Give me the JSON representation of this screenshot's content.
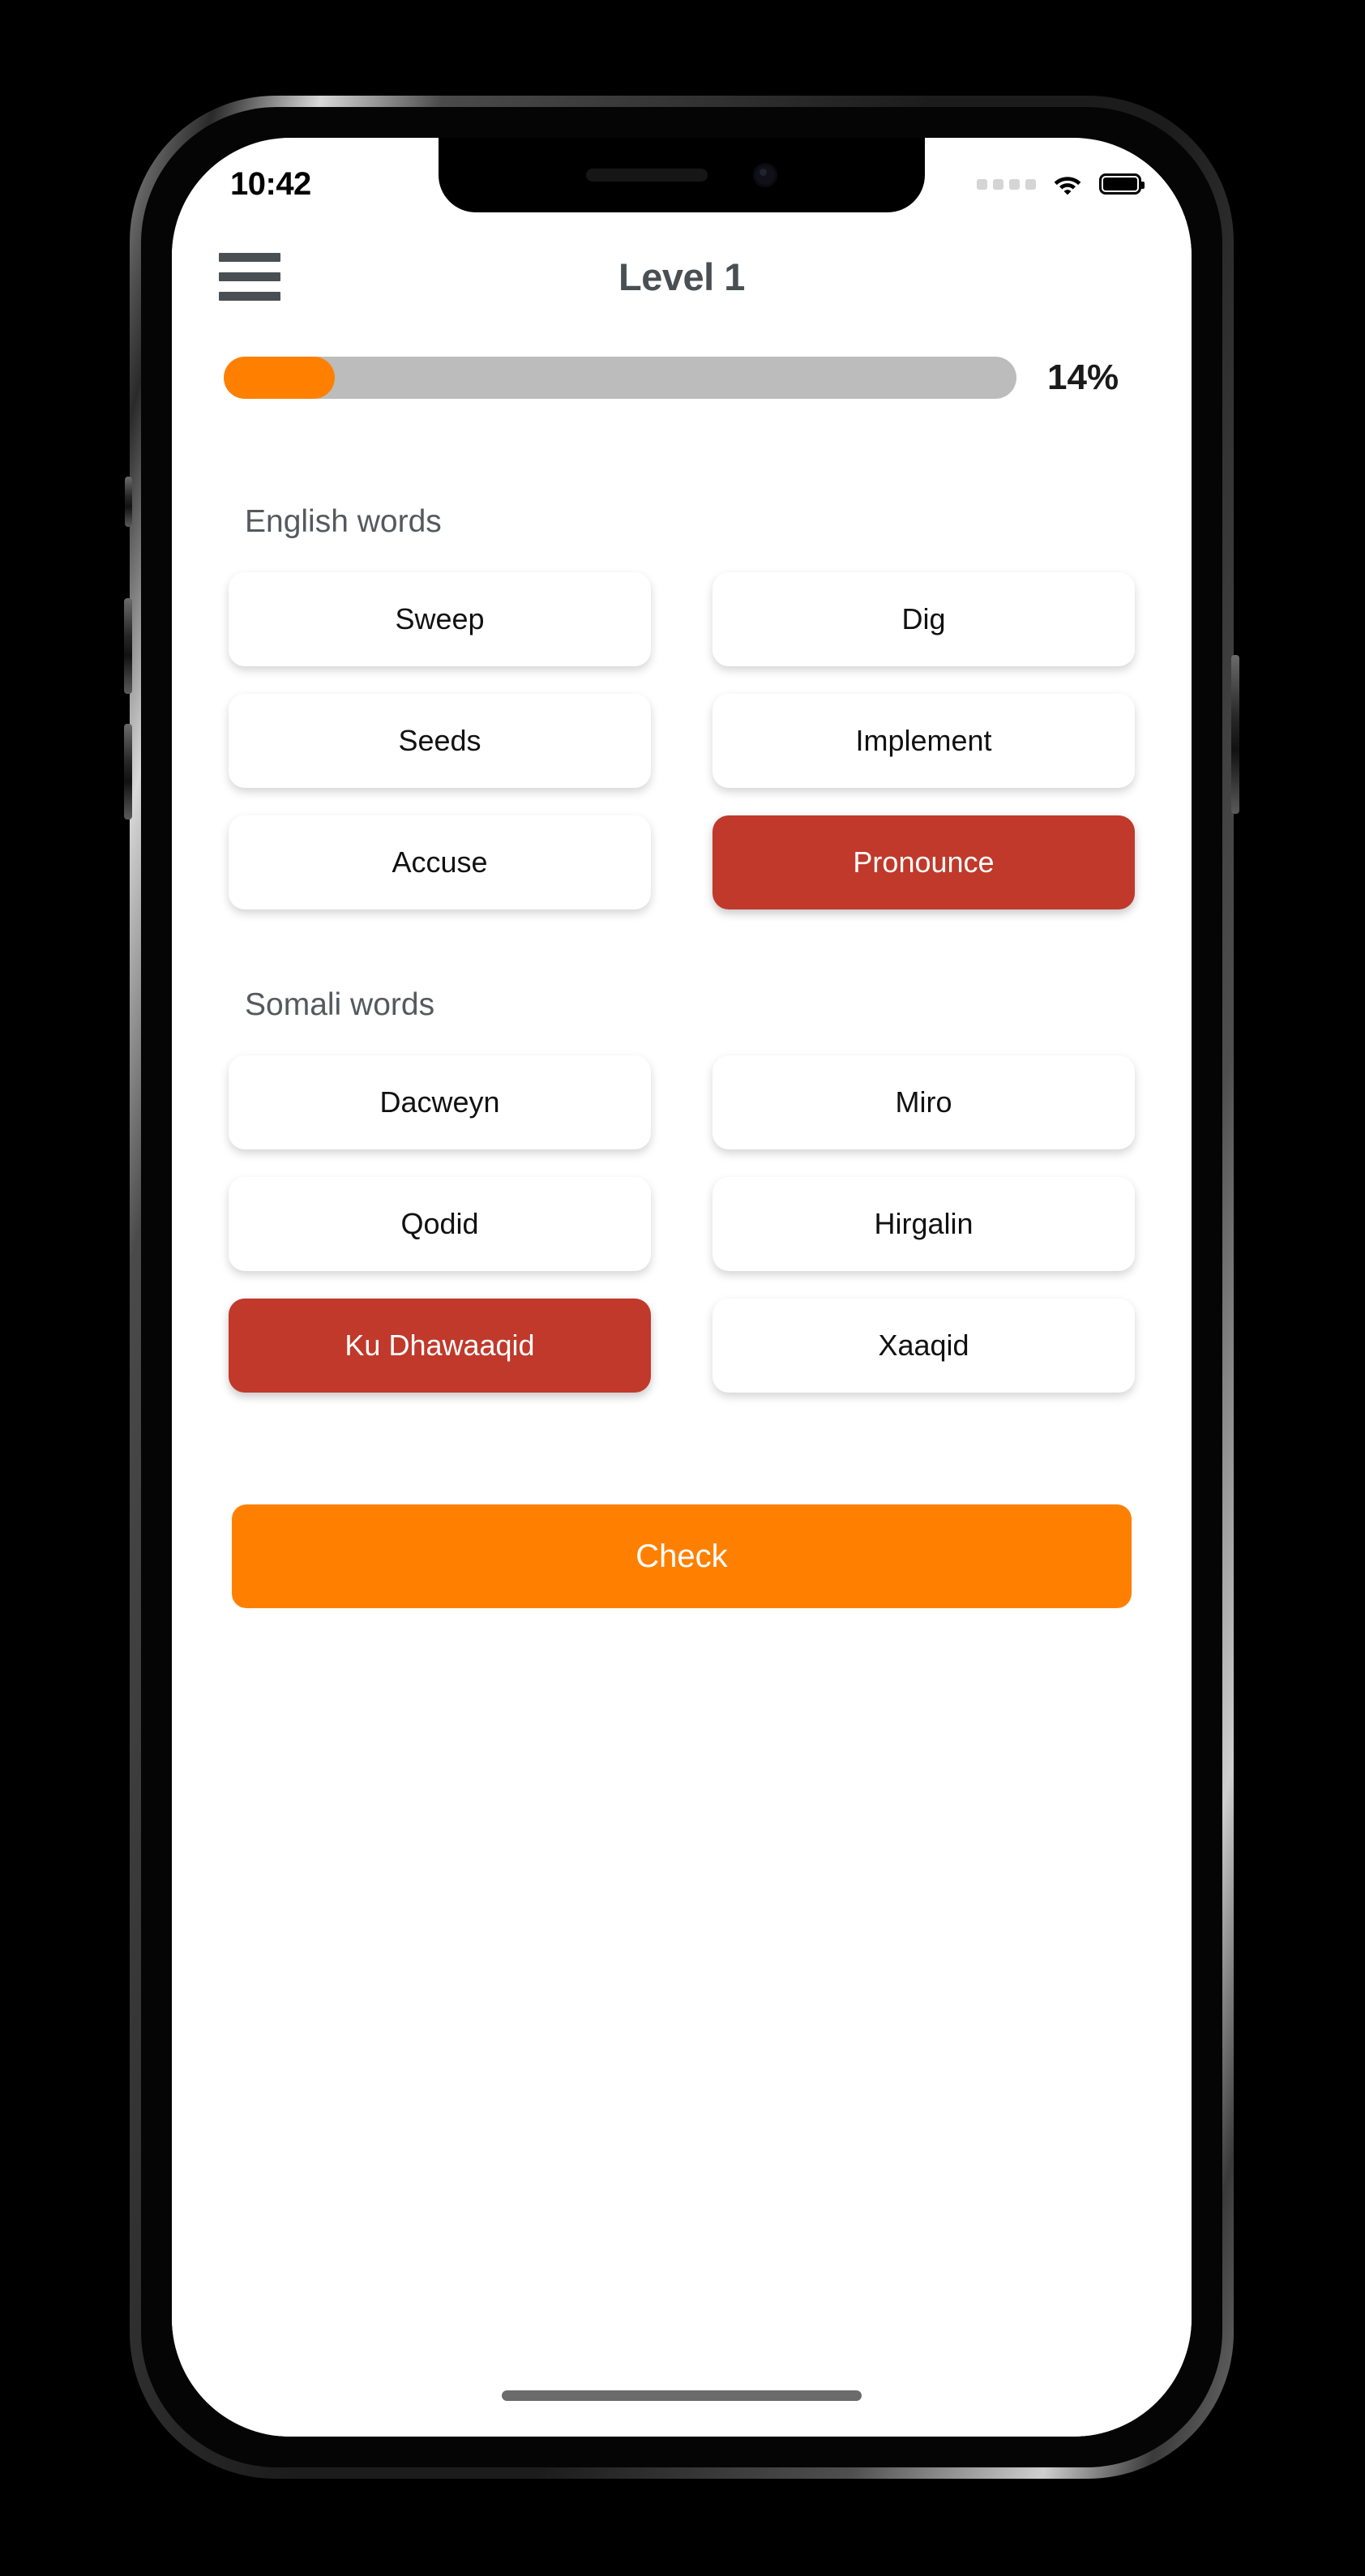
{
  "status_bar": {
    "time": "10:42",
    "signal_dots": 4,
    "wifi_icon": "wifi-icon",
    "battery_icon": "battery-full-icon"
  },
  "header": {
    "menu_icon": "hamburger-menu-icon",
    "title": "Level 1"
  },
  "progress": {
    "percent_label": "14%",
    "percent_value": 14,
    "fill_color": "#FF8000",
    "track_color": "#BCBCBC"
  },
  "sections": [
    {
      "id": "english",
      "title": "English words",
      "cards": [
        {
          "label": "Sweep",
          "selected": false
        },
        {
          "label": "Dig",
          "selected": false
        },
        {
          "label": "Seeds",
          "selected": false
        },
        {
          "label": "Implement",
          "selected": false
        },
        {
          "label": "Accuse",
          "selected": false
        },
        {
          "label": "Pronounce",
          "selected": true
        }
      ]
    },
    {
      "id": "somali",
      "title": "Somali words",
      "cards": [
        {
          "label": "Dacweyn",
          "selected": false
        },
        {
          "label": "Miro",
          "selected": false
        },
        {
          "label": "Qodid",
          "selected": false
        },
        {
          "label": "Hirgalin",
          "selected": false
        },
        {
          "label": "Ku Dhawaaqid",
          "selected": true
        },
        {
          "label": "Xaaqid",
          "selected": false
        }
      ]
    }
  ],
  "check_button": {
    "label": "Check",
    "color": "#FF8000"
  },
  "colors": {
    "selected_card": "#C0392B",
    "accent_orange": "#FF8000",
    "title_grey": "#4A4F54",
    "section_grey": "#55595E"
  }
}
